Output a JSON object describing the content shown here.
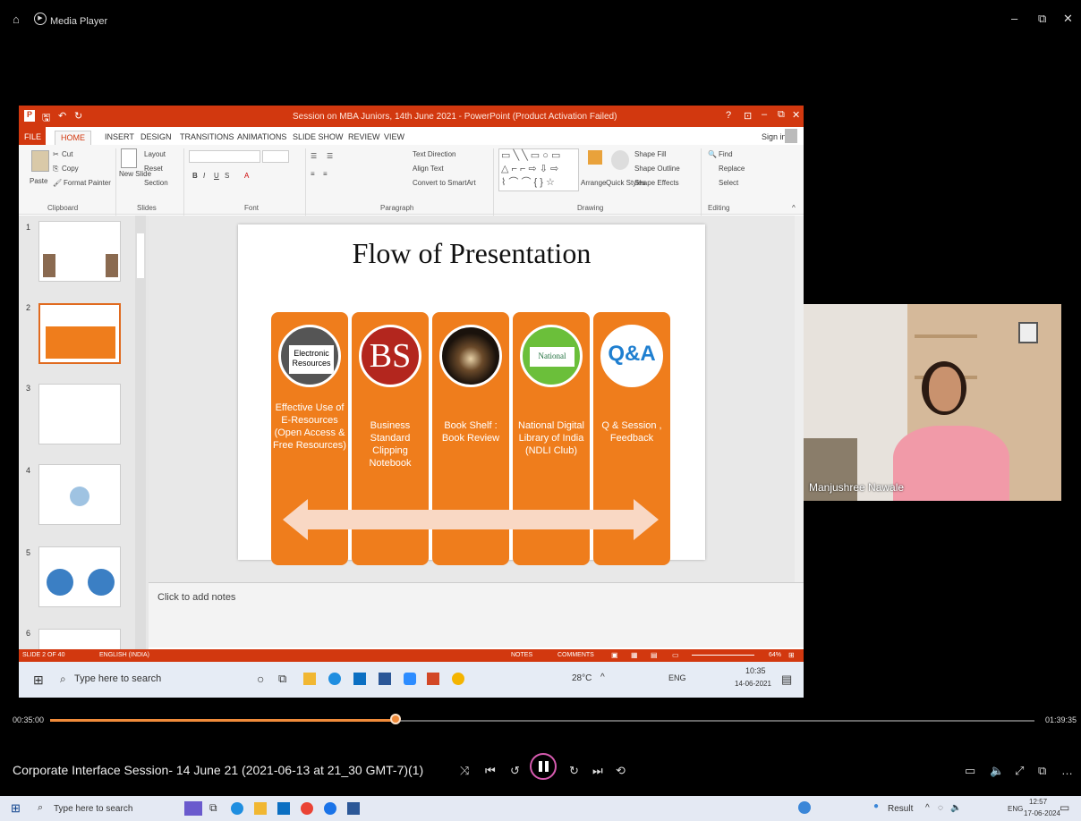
{
  "media_player": {
    "title": "Media Player",
    "current_time": "00:35:00",
    "total_time": "01:39:35",
    "progress": 0.351,
    "now_playing": "Corporate Interface Session- 14 June 21 (2021-06-13 at 21_30 GMT-7)(1)"
  },
  "ppt": {
    "title": "Session on MBA Juniors, 14th June 2021 - PowerPoint (Product Activation Failed)",
    "tabs": [
      "FILE",
      "HOME",
      "INSERT",
      "DESIGN",
      "TRANSITIONS",
      "ANIMATIONS",
      "SLIDE SHOW",
      "REVIEW",
      "VIEW"
    ],
    "signin": "Sign in",
    "ribbon": {
      "cut": "Cut",
      "copy": "Copy",
      "paste": "Paste",
      "format_painter": "Format Painter",
      "clipboard": "Clipboard",
      "new_slide": "New Slide",
      "layout": "Layout",
      "reset": "Reset",
      "section": "Section",
      "slides": "Slides",
      "font": "Font",
      "paragraph": "Paragraph",
      "text_direction": "Text Direction",
      "align_text": "Align Text",
      "convert_smartart": "Convert to SmartArt",
      "arrange": "Arrange",
      "quick_styles": "Quick Styles",
      "shape_fill": "Shape Fill",
      "shape_outline": "Shape Outline",
      "shape_effects": "Shape Effects",
      "drawing": "Drawing",
      "find": "Find",
      "replace": "Replace",
      "select": "Select",
      "editing": "Editing"
    },
    "slide_numbers": [
      "1",
      "2",
      "3",
      "4",
      "5",
      "6"
    ],
    "slide": {
      "title": "Flow of Presentation",
      "columns": [
        {
          "text": "Effective Use of E-Resources (Open Access & Free Resources)",
          "img": "Electronic Resources"
        },
        {
          "text": "Business Standard Clipping Notebook",
          "img": "BS"
        },
        {
          "text": "Book Shelf : Book Review",
          "img": ""
        },
        {
          "text": "National Digital Library of India (NDLI Club)",
          "img": "National"
        },
        {
          "text": "Q & Session , Feedback",
          "img": "Q&A"
        }
      ]
    },
    "notes_placeholder": "Click to add notes",
    "status_slide": "SLIDE 2 OF 40",
    "status_lang": "ENGLISH (INDIA)",
    "notes_btn": "NOTES",
    "comments_btn": "COMMENTS",
    "zoom": "64%",
    "inner_taskbar": {
      "search": "Type here to search",
      "temp": "28°C",
      "lang": "ENG",
      "time": "10:35",
      "date": "14-06-2021"
    }
  },
  "webcam": {
    "name": "Manjushree Nawale"
  },
  "windows_taskbar": {
    "search": "Type here to search",
    "result": "Result",
    "lang": "ENG",
    "time": "12:57",
    "date": "17-06-2024"
  }
}
